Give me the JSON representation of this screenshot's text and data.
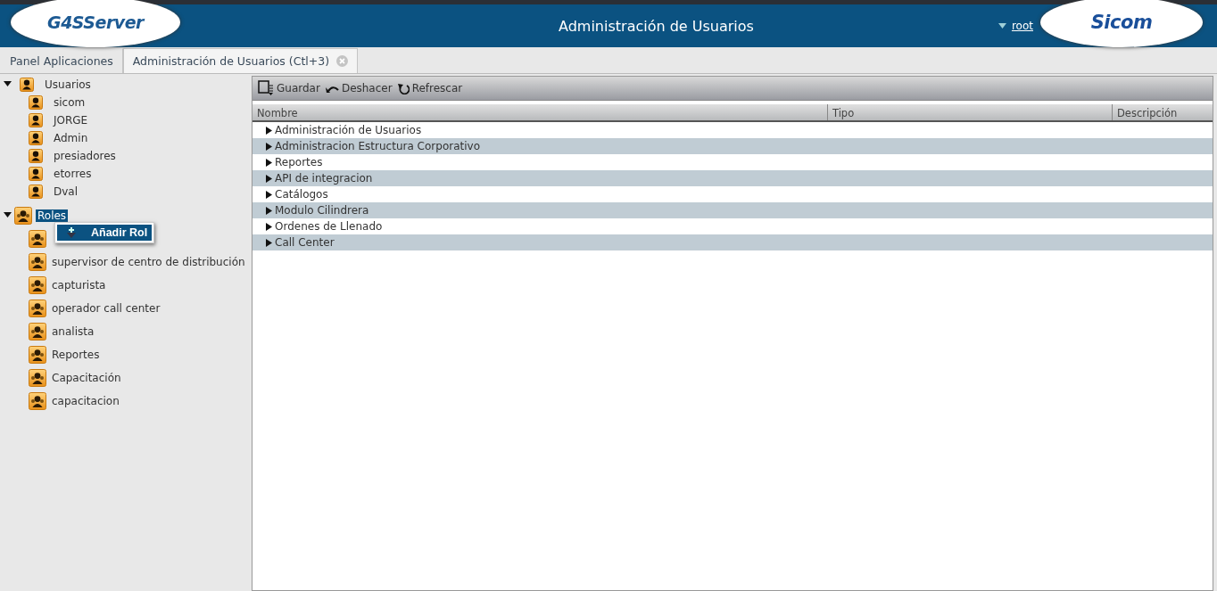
{
  "header": {
    "left_logo": "G4SServer",
    "title": "Administración de Usuarios",
    "user": "root",
    "right_logo": "Sicom"
  },
  "tabs": [
    {
      "label": "Panel Aplicaciones",
      "selected": false,
      "closable": false
    },
    {
      "label": "Administración de Usuarios (Ctl+3)",
      "selected": true,
      "closable": true
    }
  ],
  "sidebar": {
    "tree": [
      {
        "label": "Usuarios",
        "kind": "user",
        "expanded": true,
        "selected": false,
        "children": [
          {
            "label": "sicom",
            "kind": "user"
          },
          {
            "label": "JORGE",
            "kind": "user"
          },
          {
            "label": "Admin",
            "kind": "user"
          },
          {
            "label": "presiadores",
            "kind": "user"
          },
          {
            "label": "etorres",
            "kind": "user"
          },
          {
            "label": "Dval",
            "kind": "user"
          }
        ]
      },
      {
        "label": "Roles",
        "kind": "role",
        "expanded": true,
        "selected": true,
        "children": [
          {
            "kind": "role"
          },
          {
            "label": "supervisor de centro de distribución",
            "kind": "role"
          },
          {
            "label": "capturista",
            "kind": "role"
          },
          {
            "label": "operador call center",
            "kind": "role"
          },
          {
            "label": "analista",
            "kind": "role"
          },
          {
            "label": "Reportes",
            "kind": "role"
          },
          {
            "label": "Capacitación",
            "kind": "role"
          },
          {
            "label": "capacitacion",
            "kind": "role"
          }
        ]
      }
    ],
    "context_menu": {
      "items": [
        {
          "label": "Añadir Rol",
          "selected": true
        }
      ]
    }
  },
  "toolbar": [
    {
      "label": "Guardar",
      "kind": "save"
    },
    {
      "label": "Deshacer",
      "kind": "undo"
    },
    {
      "label": "Refrescar",
      "kind": "refresh"
    }
  ],
  "table": {
    "columns": [
      "Nombre",
      "Tipo",
      "Descripción"
    ],
    "rows": [
      {
        "name": "Administración de Usuarios"
      },
      {
        "name": "Administracion Estructura Corporativo"
      },
      {
        "name": "Reportes"
      },
      {
        "name": "API de integracion"
      },
      {
        "name": "Catálogos"
      },
      {
        "name": "Modulo Cilindrera"
      },
      {
        "name": "Ordenes de Llenado"
      },
      {
        "name": "Call Center"
      }
    ]
  }
}
